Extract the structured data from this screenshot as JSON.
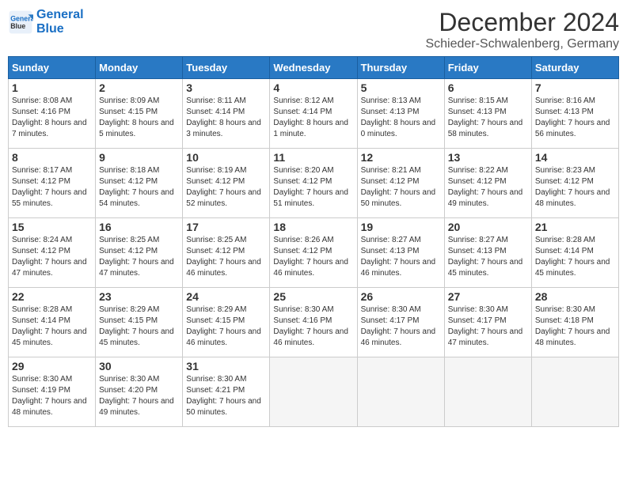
{
  "header": {
    "logo_line1": "General",
    "logo_line2": "Blue",
    "month": "December 2024",
    "location": "Schieder-Schwalenberg, Germany"
  },
  "days_of_week": [
    "Sunday",
    "Monday",
    "Tuesday",
    "Wednesday",
    "Thursday",
    "Friday",
    "Saturday"
  ],
  "weeks": [
    [
      {
        "day": "1",
        "sunrise": "Sunrise: 8:08 AM",
        "sunset": "Sunset: 4:16 PM",
        "daylight": "Daylight: 8 hours and 7 minutes."
      },
      {
        "day": "2",
        "sunrise": "Sunrise: 8:09 AM",
        "sunset": "Sunset: 4:15 PM",
        "daylight": "Daylight: 8 hours and 5 minutes."
      },
      {
        "day": "3",
        "sunrise": "Sunrise: 8:11 AM",
        "sunset": "Sunset: 4:14 PM",
        "daylight": "Daylight: 8 hours and 3 minutes."
      },
      {
        "day": "4",
        "sunrise": "Sunrise: 8:12 AM",
        "sunset": "Sunset: 4:14 PM",
        "daylight": "Daylight: 8 hours and 1 minute."
      },
      {
        "day": "5",
        "sunrise": "Sunrise: 8:13 AM",
        "sunset": "Sunset: 4:13 PM",
        "daylight": "Daylight: 8 hours and 0 minutes."
      },
      {
        "day": "6",
        "sunrise": "Sunrise: 8:15 AM",
        "sunset": "Sunset: 4:13 PM",
        "daylight": "Daylight: 7 hours and 58 minutes."
      },
      {
        "day": "7",
        "sunrise": "Sunrise: 8:16 AM",
        "sunset": "Sunset: 4:13 PM",
        "daylight": "Daylight: 7 hours and 56 minutes."
      }
    ],
    [
      {
        "day": "8",
        "sunrise": "Sunrise: 8:17 AM",
        "sunset": "Sunset: 4:12 PM",
        "daylight": "Daylight: 7 hours and 55 minutes."
      },
      {
        "day": "9",
        "sunrise": "Sunrise: 8:18 AM",
        "sunset": "Sunset: 4:12 PM",
        "daylight": "Daylight: 7 hours and 54 minutes."
      },
      {
        "day": "10",
        "sunrise": "Sunrise: 8:19 AM",
        "sunset": "Sunset: 4:12 PM",
        "daylight": "Daylight: 7 hours and 52 minutes."
      },
      {
        "day": "11",
        "sunrise": "Sunrise: 8:20 AM",
        "sunset": "Sunset: 4:12 PM",
        "daylight": "Daylight: 7 hours and 51 minutes."
      },
      {
        "day": "12",
        "sunrise": "Sunrise: 8:21 AM",
        "sunset": "Sunset: 4:12 PM",
        "daylight": "Daylight: 7 hours and 50 minutes."
      },
      {
        "day": "13",
        "sunrise": "Sunrise: 8:22 AM",
        "sunset": "Sunset: 4:12 PM",
        "daylight": "Daylight: 7 hours and 49 minutes."
      },
      {
        "day": "14",
        "sunrise": "Sunrise: 8:23 AM",
        "sunset": "Sunset: 4:12 PM",
        "daylight": "Daylight: 7 hours and 48 minutes."
      }
    ],
    [
      {
        "day": "15",
        "sunrise": "Sunrise: 8:24 AM",
        "sunset": "Sunset: 4:12 PM",
        "daylight": "Daylight: 7 hours and 47 minutes."
      },
      {
        "day": "16",
        "sunrise": "Sunrise: 8:25 AM",
        "sunset": "Sunset: 4:12 PM",
        "daylight": "Daylight: 7 hours and 47 minutes."
      },
      {
        "day": "17",
        "sunrise": "Sunrise: 8:25 AM",
        "sunset": "Sunset: 4:12 PM",
        "daylight": "Daylight: 7 hours and 46 minutes."
      },
      {
        "day": "18",
        "sunrise": "Sunrise: 8:26 AM",
        "sunset": "Sunset: 4:12 PM",
        "daylight": "Daylight: 7 hours and 46 minutes."
      },
      {
        "day": "19",
        "sunrise": "Sunrise: 8:27 AM",
        "sunset": "Sunset: 4:13 PM",
        "daylight": "Daylight: 7 hours and 46 minutes."
      },
      {
        "day": "20",
        "sunrise": "Sunrise: 8:27 AM",
        "sunset": "Sunset: 4:13 PM",
        "daylight": "Daylight: 7 hours and 45 minutes."
      },
      {
        "day": "21",
        "sunrise": "Sunrise: 8:28 AM",
        "sunset": "Sunset: 4:14 PM",
        "daylight": "Daylight: 7 hours and 45 minutes."
      }
    ],
    [
      {
        "day": "22",
        "sunrise": "Sunrise: 8:28 AM",
        "sunset": "Sunset: 4:14 PM",
        "daylight": "Daylight: 7 hours and 45 minutes."
      },
      {
        "day": "23",
        "sunrise": "Sunrise: 8:29 AM",
        "sunset": "Sunset: 4:15 PM",
        "daylight": "Daylight: 7 hours and 45 minutes."
      },
      {
        "day": "24",
        "sunrise": "Sunrise: 8:29 AM",
        "sunset": "Sunset: 4:15 PM",
        "daylight": "Daylight: 7 hours and 46 minutes."
      },
      {
        "day": "25",
        "sunrise": "Sunrise: 8:30 AM",
        "sunset": "Sunset: 4:16 PM",
        "daylight": "Daylight: 7 hours and 46 minutes."
      },
      {
        "day": "26",
        "sunrise": "Sunrise: 8:30 AM",
        "sunset": "Sunset: 4:17 PM",
        "daylight": "Daylight: 7 hours and 46 minutes."
      },
      {
        "day": "27",
        "sunrise": "Sunrise: 8:30 AM",
        "sunset": "Sunset: 4:17 PM",
        "daylight": "Daylight: 7 hours and 47 minutes."
      },
      {
        "day": "28",
        "sunrise": "Sunrise: 8:30 AM",
        "sunset": "Sunset: 4:18 PM",
        "daylight": "Daylight: 7 hours and 48 minutes."
      }
    ],
    [
      {
        "day": "29",
        "sunrise": "Sunrise: 8:30 AM",
        "sunset": "Sunset: 4:19 PM",
        "daylight": "Daylight: 7 hours and 48 minutes."
      },
      {
        "day": "30",
        "sunrise": "Sunrise: 8:30 AM",
        "sunset": "Sunset: 4:20 PM",
        "daylight": "Daylight: 7 hours and 49 minutes."
      },
      {
        "day": "31",
        "sunrise": "Sunrise: 8:30 AM",
        "sunset": "Sunset: 4:21 PM",
        "daylight": "Daylight: 7 hours and 50 minutes."
      },
      null,
      null,
      null,
      null
    ]
  ]
}
